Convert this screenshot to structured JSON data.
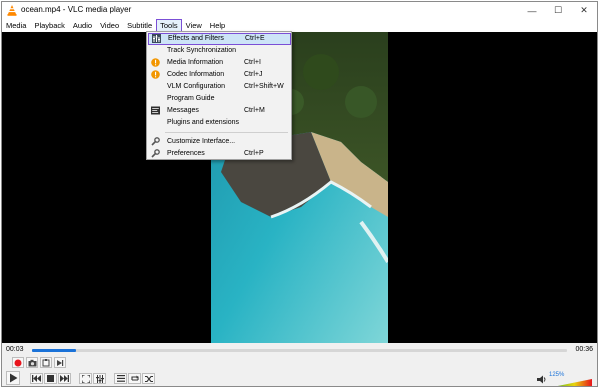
{
  "window": {
    "title": "ocean.mp4 - VLC media player",
    "controls": {
      "minimize": "—",
      "maximize": "☐",
      "close": "✕"
    }
  },
  "menubar": {
    "items": [
      {
        "label": "Media"
      },
      {
        "label": "Playback"
      },
      {
        "label": "Audio"
      },
      {
        "label": "Video"
      },
      {
        "label": "Subtitle"
      },
      {
        "label": "Tools",
        "active": true
      },
      {
        "label": "View"
      },
      {
        "label": "Help"
      }
    ]
  },
  "tools_menu": {
    "items": [
      {
        "label": "Effects and Filters",
        "shortcut": "Ctrl+E",
        "icon": "equalizer-icon",
        "highlighted": true
      },
      {
        "label": "Track Synchronization",
        "shortcut": "",
        "icon": ""
      },
      {
        "label": "Media Information",
        "shortcut": "Ctrl+I",
        "icon": "info-warning-icon"
      },
      {
        "label": "Codec Information",
        "shortcut": "Ctrl+J",
        "icon": "info-warning-icon"
      },
      {
        "label": "VLM Configuration",
        "shortcut": "Ctrl+Shift+W",
        "icon": ""
      },
      {
        "label": "Program Guide",
        "shortcut": "",
        "icon": ""
      },
      {
        "label": "Messages",
        "shortcut": "Ctrl+M",
        "icon": "messages-icon"
      },
      {
        "label": "Plugins and extensions",
        "shortcut": "",
        "icon": ""
      },
      {
        "label": "Customize Interface...",
        "shortcut": "",
        "icon": "wrench-icon"
      },
      {
        "label": "Preferences",
        "shortcut": "Ctrl+P",
        "icon": "wrench-icon"
      }
    ]
  },
  "playback": {
    "elapsed": "00:03",
    "duration": "00:36",
    "progress": 0.083
  },
  "volume": {
    "percent_label": "125%",
    "level": 1.0
  },
  "colors": {
    "accent": "#1a72d8",
    "highlight_outline": "#7b4fd6",
    "record": "#e8141c",
    "vlc_orange": "#ff8800"
  }
}
